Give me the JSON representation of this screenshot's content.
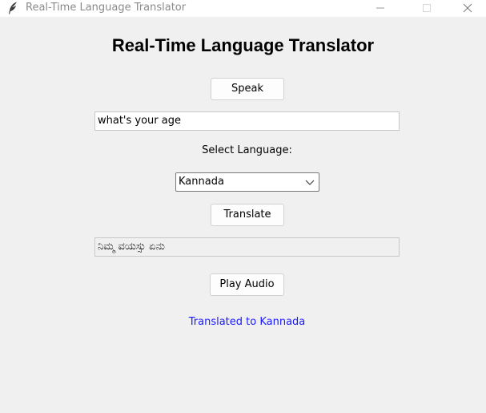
{
  "window": {
    "title": "Real-Time Language Translator"
  },
  "heading": "Real-Time Language Translator",
  "speak_button": "Speak",
  "input": {
    "value": "what's your age"
  },
  "select_label": "Select Language:",
  "language_select": {
    "selected": "Kannada"
  },
  "translate_button": "Translate",
  "output": {
    "value": "ನಿಮ್ಮ ವಯಸ್ಸು ಏನು"
  },
  "play_button": "Play Audio",
  "status": "Translated to Kannada",
  "colors": {
    "status_text": "#1a1aff",
    "background": "#f0f0f0"
  },
  "icons": {
    "app": "feather-icon",
    "minimize": "minimize-icon",
    "maximize": "maximize-icon",
    "close": "close-icon",
    "dropdown": "chevron-down-icon"
  }
}
